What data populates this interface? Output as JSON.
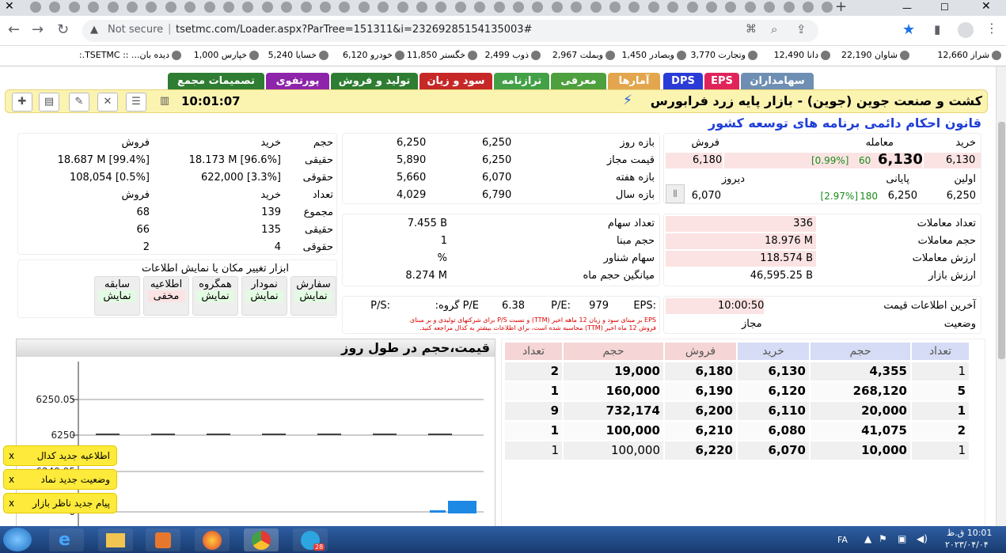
{
  "browser": {
    "security_label": "Not secure",
    "url": "tsetmc.com/Loader.aspx?ParTree=151311&i=23269285154135003#"
  },
  "bookmarks": [
    {
      "label": "شراز 12,660"
    },
    {
      "label": "شاوان 22,190"
    },
    {
      "label": "دانا 12,490"
    },
    {
      "label": "وتجارت 3,770"
    },
    {
      "label": "وبصادر 1,450"
    },
    {
      "label": "وبملت 2,967"
    },
    {
      "label": "ذوب 2,499"
    },
    {
      "label": "خگستر 11,850"
    },
    {
      "label": "خودرو 6,120"
    },
    {
      "label": "خسایا 5,240"
    },
    {
      "label": "خپارس 1,000"
    },
    {
      "label": "دیده بان... :: TSETMC.:"
    }
  ],
  "nav_tabs": [
    {
      "label": "سهامداران",
      "color": "#6e8fb3"
    },
    {
      "label": "EPS",
      "color": "#e0245a"
    },
    {
      "label": "DPS",
      "color": "#2b3bd6"
    },
    {
      "label": "آمارها",
      "color": "#e3a64e"
    },
    {
      "label": "معرفی",
      "color": "#4e9f3d"
    },
    {
      "label": "ترازنامه",
      "color": "#43a047"
    },
    {
      "label": "سود و زیان",
      "color": "#c62828"
    },
    {
      "label": "تولید و فروش",
      "color": "#2e7d32"
    },
    {
      "label": "پورتفوی",
      "color": "#8e24aa"
    },
    {
      "label": "تصمیمات مجمع",
      "color": "#2e7d32"
    }
  ],
  "header": {
    "company": "کشت و صنعت جوین (جوین) - بازار پایه زرد فرابورس",
    "time": "10:01:07",
    "notice": "قانون احکام دائمی برنامه های توسعه کشور"
  },
  "price_panel": {
    "h_buy": "خرید",
    "h_trade": "معامله",
    "h_sell": "فروش",
    "buy": "6,130",
    "last_price": "6,130",
    "last_change": "60",
    "last_pct": "[0.99%]",
    "sell": "6,180",
    "l_first": "اولین",
    "l_closing": "پایانی",
    "l_yesterday": "دیروز",
    "first": "6,250",
    "closing": "6,250",
    "closing_change": "180",
    "closing_pct": "[2.97%]",
    "yesterday": "6,070"
  },
  "range_panel": [
    {
      "label": "بازه روز",
      "a": "6,250",
      "b": "6,250"
    },
    {
      "label": "قیمت مجاز",
      "a": "6,250",
      "b": "5,890"
    },
    {
      "label": "بازه هفته",
      "a": "6,070",
      "b": "5,660"
    },
    {
      "label": "بازه سال",
      "a": "6,790",
      "b": "4,029"
    }
  ],
  "holders_panel": {
    "h_volume": "حجم",
    "h_buy": "خرید",
    "h_sell": "فروش",
    "real_label": "حقیقی",
    "real_buy": "18.173 M [96.6%]",
    "real_sell": "18.687 M [99.4%]",
    "legal_label": "حقوقی",
    "legal_buy": "622,000 [3.3%]",
    "legal_sell": "108,054 [0.5%]",
    "h_count": "تعداد",
    "h_buy2": "خرید",
    "h_sell2": "فروش",
    "total_label": "مجموع",
    "total_buy": "139",
    "total_sell": "68",
    "real2_label": "حقیقی",
    "real2_buy": "135",
    "real2_sell": "66",
    "legal2_label": "حقوقی",
    "legal2_buy": "4",
    "legal2_sell": "2"
  },
  "stats_left": [
    {
      "label": "تعداد معاملات",
      "value": "336"
    },
    {
      "label": "حجم معاملات",
      "value": "18.976 M"
    },
    {
      "label": "ارزش معاملات",
      "value": "118.574 B"
    },
    {
      "label": "ارزش بازار",
      "value": "46,595.25 B"
    }
  ],
  "stats_mid": [
    {
      "label": "تعداد سهام",
      "value": "7.455 B"
    },
    {
      "label": "حجم مبنا",
      "value": "1"
    },
    {
      "label": "سهام شناور",
      "value": "%"
    },
    {
      "label": "میانگین حجم ماه",
      "value": "8.274 M"
    }
  ],
  "tools": {
    "title": "ابزار تغییر مکان یا نمایش اطلاعات",
    "buttons": [
      {
        "name": "سفارش",
        "state": "نمایش"
      },
      {
        "name": "نمودار",
        "state": "نمایش"
      },
      {
        "name": "همگروه",
        "state": "نمایش"
      },
      {
        "name": "اطلاعیه",
        "state": "مخفی"
      },
      {
        "name": "سابقه",
        "state": "نمایش"
      }
    ]
  },
  "info": {
    "last_info_label": "آخرین اطلاعات قیمت",
    "last_info_time": "10:00:50",
    "status_label": "وضعیت",
    "status": "مجاز",
    "eps_label": "EPS:",
    "eps": "979",
    "pe_label": "P/E:",
    "pe": "6.38",
    "group_pe_label": "P/E گروه:",
    "ps_label": "P/S:",
    "footnote1": "EPS بر مبنای سود و زیان 12 ماهه اخیر (TTM) و نسبت P/S برای شرکتهای تولیدی و بر مبنای",
    "footnote2": "فروش 12 ماه اخیر (TTM) محاسبه شده است، برای اطلاعات بیشتر به کدال مراجعه کنید."
  },
  "chart_data": {
    "type": "line",
    "title": "قیمت،حجم در طول روز",
    "yticks": [
      "6250.05",
      "6250",
      "6249.95",
      "0"
    ],
    "series": [
      {
        "values": [
          6250,
          6250,
          6250,
          6250,
          6250
        ]
      }
    ]
  },
  "order_book": {
    "headers": {
      "count_buy": "تعداد",
      "volume_buy": "حجم",
      "buy": "خرید",
      "sell": "فروش",
      "volume_sell": "حجم",
      "count_sell": "تعداد"
    },
    "rows": [
      {
        "count_buy": "1",
        "volume_buy": "4,355",
        "buy": "6,130",
        "sell": "6,180",
        "volume_sell": "19,000",
        "count_sell": "2"
      },
      {
        "count_buy": "5",
        "volume_buy": "268,120",
        "buy": "6,120",
        "sell": "6,190",
        "volume_sell": "160,000",
        "count_sell": "1"
      },
      {
        "count_buy": "1",
        "volume_buy": "20,000",
        "buy": "6,110",
        "sell": "6,200",
        "volume_sell": "732,174",
        "count_sell": "9"
      },
      {
        "count_buy": "2",
        "volume_buy": "41,075",
        "buy": "6,080",
        "sell": "6,210",
        "volume_sell": "100,000",
        "count_sell": "1"
      },
      {
        "count_buy": "1",
        "volume_buy": "10,000",
        "buy": "6,070",
        "sell": "6,220",
        "volume_sell": "100,000",
        "count_sell": "1"
      }
    ]
  },
  "notifications": [
    {
      "text": "اطلاعیه جدید کدال",
      "close": "x"
    },
    {
      "text": "وضعیت جدید نماد",
      "close": "x"
    },
    {
      "text": "پیام جدید ناظر بازار",
      "close": "x"
    }
  ],
  "taskbar": {
    "lang": "FA",
    "time": "10:01 ق.ظ",
    "date": "۲۰۲۳/۰۴/۰۴",
    "badge": "28"
  }
}
